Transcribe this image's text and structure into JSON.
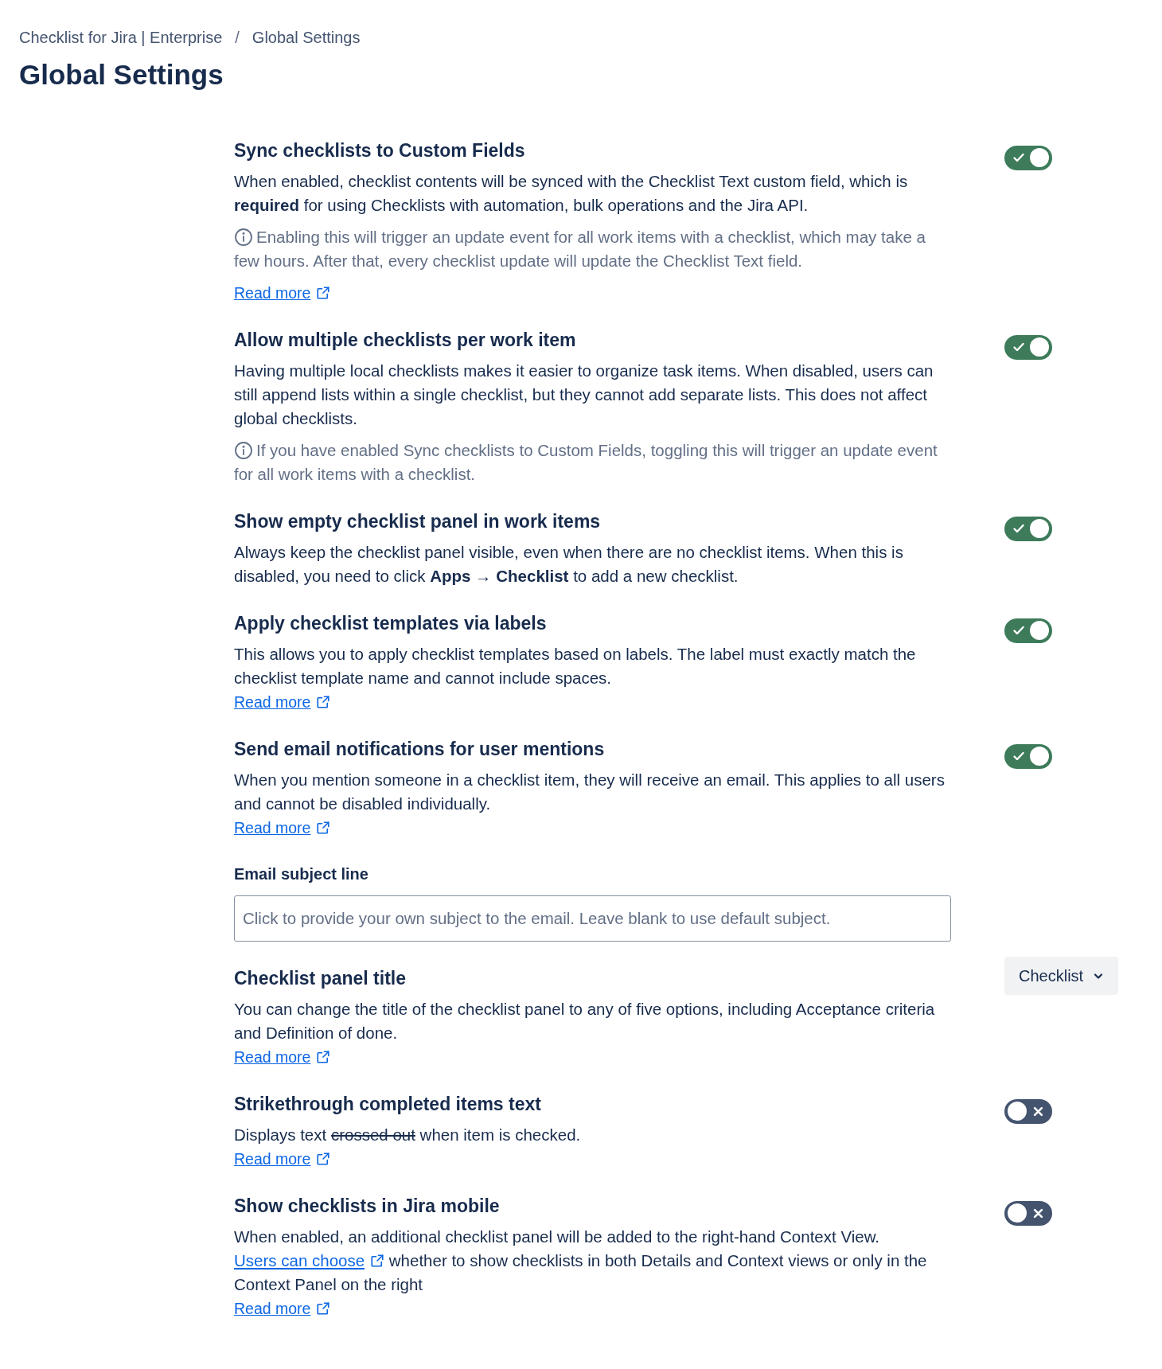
{
  "breadcrumbs": [
    "Checklist for Jira | Enterprise",
    "Global Settings"
  ],
  "breadcrumb_separator": "/",
  "title": "Global Settings",
  "settings": [
    {
      "kind": "setting",
      "title": "Sync checklists to Custom Fields",
      "description": [
        {
          "kind": "text",
          "text": "When enabled, checklist contents will be synced with the Checklist Text custom field, which is **required** for using Checklists with automation, bulk operations and the Jira API."
        }
      ],
      "note": "Enabling this will trigger an update event for all work items with a checklist, which may take a few hours. After that, every checklist update will update the Checklist Text field.",
      "link": "Read more",
      "control": {
        "kind": "toggle",
        "on": true
      }
    },
    {
      "kind": "setting",
      "title": "Allow multiple checklists per work item",
      "description": [
        {
          "kind": "text",
          "text": "Having multiple local checklists makes it easier to organize task items. When disabled, users can still append lists within a single checklist, but they cannot add separate lists. This does not affect global checklists."
        }
      ],
      "note": "If you have enabled Sync checklists to Custom Fields, toggling this will trigger an update event for all work items with a checklist.",
      "control": {
        "kind": "toggle",
        "on": true
      }
    },
    {
      "kind": "setting",
      "title": "Show empty checklist panel in work items",
      "description": [
        {
          "kind": "text",
          "text": "Always keep the checklist panel visible, even when there are no checklist items. When this is disabled, you need to click **Apps → Checklist** to add a new checklist."
        }
      ],
      "control": {
        "kind": "toggle",
        "on": true
      }
    },
    {
      "kind": "setting",
      "title": "Apply checklist templates via labels",
      "description": [
        {
          "kind": "text",
          "text": "This allows you to apply checklist templates based on labels. The label must exactly match the checklist template name and cannot include spaces."
        }
      ],
      "link": "Read more",
      "control": {
        "kind": "toggle",
        "on": true
      }
    },
    {
      "kind": "setting",
      "title": "Send email notifications for user mentions",
      "description": [
        {
          "kind": "text",
          "text": "When you mention someone in a checklist item, they will receive an email. This applies to all users and cannot be disabled individually."
        }
      ],
      "link": "Read more",
      "control": {
        "kind": "toggle",
        "on": true
      }
    },
    {
      "kind": "field",
      "label": "Email subject line",
      "placeholder": "Click to provide your own subject to the email. Leave blank to use default subject."
    },
    {
      "kind": "setting",
      "title": "Checklist panel title",
      "description": [
        {
          "kind": "text",
          "text": "You can change the title of the checklist panel to any of five options, including Acceptance criteria and Definition of done."
        }
      ],
      "link": "Read more",
      "control": {
        "kind": "dropdown",
        "value": "Checklist"
      }
    },
    {
      "kind": "setting",
      "title": "Strikethrough completed items text",
      "description": [
        {
          "kind": "text",
          "text": "Displays text "
        },
        {
          "kind": "strike",
          "text": "crossed out"
        },
        {
          "kind": "text",
          "text": " when item is checked."
        }
      ],
      "link": "Read more",
      "control": {
        "kind": "toggle",
        "on": false
      }
    },
    {
      "kind": "setting",
      "title": "Show checklists in Jira mobile",
      "description": [
        {
          "kind": "text",
          "text": "When enabled, an additional checklist panel will be added to the right-hand Context View. "
        },
        {
          "kind": "link",
          "text": "Users can choose"
        },
        {
          "kind": "text",
          "text": " whether to show checklists in both Details and Context views or only in the Context Panel on the right"
        }
      ],
      "link": "Read more",
      "control": {
        "kind": "toggle",
        "on": false
      }
    }
  ]
}
